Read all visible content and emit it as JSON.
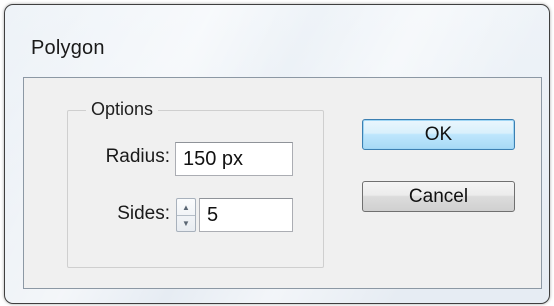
{
  "dialog": {
    "title": "Polygon",
    "options": {
      "legend": "Options",
      "radius": {
        "label": "Radius:",
        "value": "150 px"
      },
      "sides": {
        "label": "Sides:",
        "value": "5"
      }
    },
    "buttons": {
      "ok": "OK",
      "cancel": "Cancel"
    }
  },
  "icons": {
    "spin_up": "spin-up-arrow-icon",
    "spin_down": "spin-down-arrow-icon"
  },
  "colors": {
    "ok_button_accent": "#3c7fb1",
    "dialog_frame": "#e6ecf3",
    "client_bg": "#f0f0f0"
  }
}
